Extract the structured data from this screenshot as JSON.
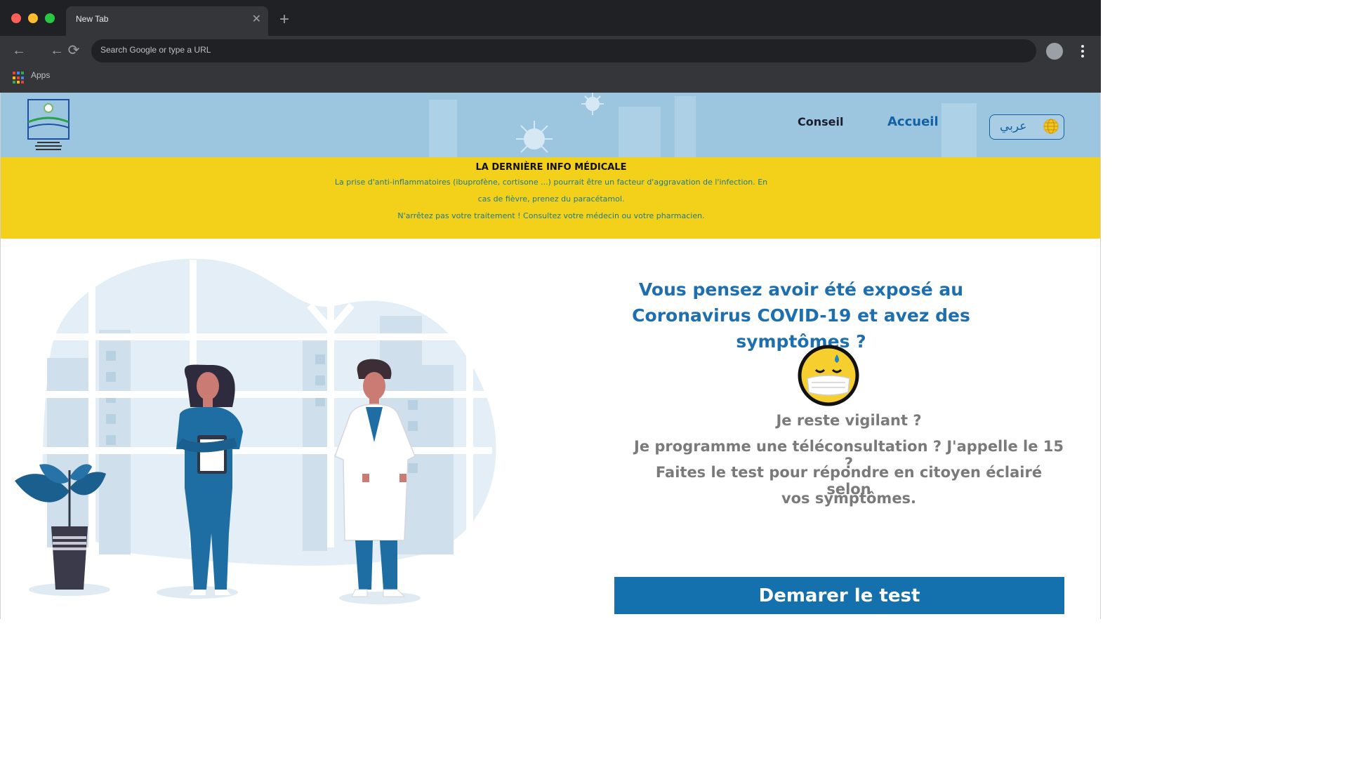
{
  "browser": {
    "tab_title": "New Tab",
    "tab_close": "✕",
    "new_tab": "+",
    "back": "←",
    "back2": "←",
    "reload": "⟳",
    "omnibox_placeholder": "Search Google or type a URL",
    "bookmarks": {
      "apps_label": "Apps"
    }
  },
  "header": {
    "nav": {
      "conseil": "Conseil",
      "accueil": "Accueil"
    },
    "language_button": "عربي",
    "colors": {
      "header_bg": "#9cc6e0",
      "nav_active": "#1261a3"
    }
  },
  "banner": {
    "title": "LA DERNIÈRE INFO MÉDICALE",
    "line1": "La prise d'anti-inflammatoires (ibuprofène, cortisone ...) pourrait être un facteur d'aggravation de l'infection. En",
    "line2": "cas de fièvre, prenez du paracétamol.",
    "line3": "N'arrêtez pas votre traitement ! Consultez votre médecin ou votre pharmacien.",
    "colors": {
      "bg": "#f3d11b",
      "text": "#1d7a8d"
    }
  },
  "main": {
    "headline_line1": "Vous pensez avoir été exposé au",
    "headline_line2": "Coronavirus COVID-19 et avez des symptômes ?",
    "sub_line1": "Je reste vigilant ?",
    "sub_line2": "Je programme une téléconsultation ? J'appelle le 15 ?",
    "sub_line3": "Faites le test pour répondre en citoyen éclairé selon",
    "sub_line4": "vos symptômes.",
    "cta_label": "Demarer le test",
    "colors": {
      "headline": "#1d6fb0",
      "cta_bg": "#1570ae"
    }
  }
}
